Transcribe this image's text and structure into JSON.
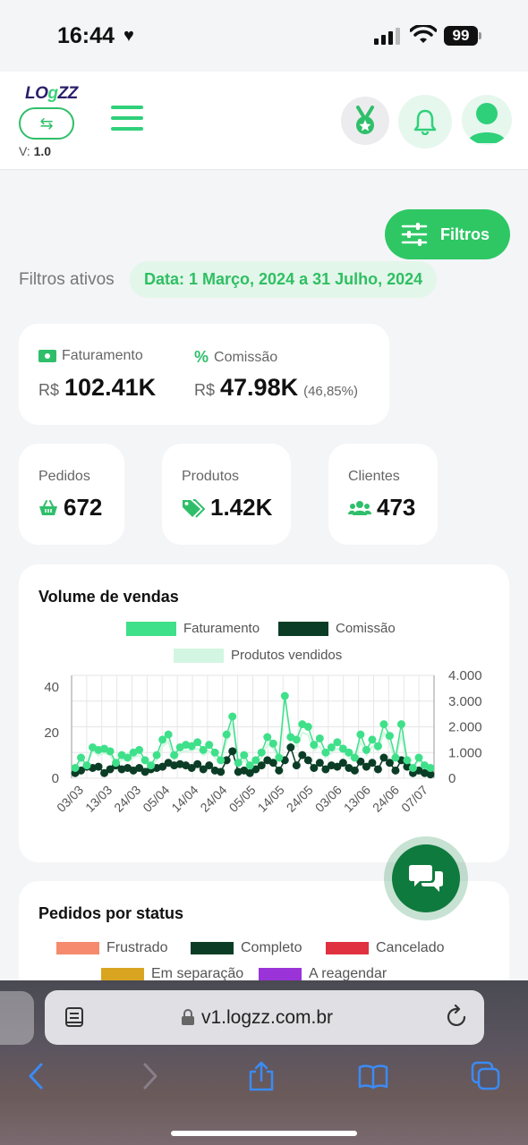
{
  "status_bar": {
    "time": "16:44",
    "battery": "99"
  },
  "header": {
    "logo_part1": "LO",
    "logo_part2": "g",
    "logo_part3": "ZZ",
    "version_prefix": "V:",
    "version": "1.0"
  },
  "filters": {
    "button_label": "Filtros",
    "active_label": "Filtros ativos",
    "date_chip": "Data: 1 Março, 2024 a 31 Julho, 2024"
  },
  "kpis": {
    "faturamento": {
      "label": "Faturamento",
      "currency": "R$",
      "value": "102.41K"
    },
    "comissao": {
      "label": "Comissão",
      "currency": "R$",
      "value": "47.98K",
      "percent": "(46,85%)"
    },
    "pedidos": {
      "label": "Pedidos",
      "value": "672"
    },
    "produtos": {
      "label": "Produtos",
      "value": "1.42K"
    },
    "clientes": {
      "label": "Clientes",
      "value": "473"
    }
  },
  "sales_chart": {
    "title": "Volume de vendas"
  },
  "chart_data": {
    "type": "line",
    "title": "Volume de vendas",
    "x_ticks": [
      "03/03",
      "13/03",
      "24/03",
      "05/04",
      "14/04",
      "24/04",
      "05/05",
      "14/05",
      "24/05",
      "03/06",
      "13/06",
      "24/06",
      "07/07"
    ],
    "y_left_ticks": [
      "0",
      "20",
      "40"
    ],
    "y_right_ticks": [
      "0",
      "1.000",
      "2.000",
      "3.000",
      "4.000"
    ],
    "ylim_left": [
      0,
      45
    ],
    "ylim_right": [
      0,
      4000
    ],
    "legend_position": "top",
    "grid": true,
    "colors": {
      "faturamento": "#3fe08a",
      "comissao": "#0b3d26",
      "produtos": "#d2f6e2"
    },
    "series": [
      {
        "name": "Faturamento",
        "axis": "right",
        "values": [
          400,
          800,
          500,
          1200,
          1100,
          1150,
          1050,
          600,
          900,
          800,
          1000,
          1100,
          700,
          500,
          900,
          1500,
          1700,
          900,
          1200,
          1300,
          1250,
          1400,
          1100,
          1300,
          1000,
          700,
          1700,
          2400,
          600,
          900,
          500,
          700,
          1000,
          1600,
          1350,
          800,
          3200,
          1600,
          1500,
          2100,
          2000,
          1300,
          1550,
          1000,
          1200,
          1400,
          1150,
          1000,
          800,
          1700,
          1100,
          1500,
          1250,
          2100,
          1650,
          800,
          2100,
          700,
          400,
          800,
          500,
          400
        ]
      },
      {
        "name": "Comissão",
        "axis": "right",
        "values": [
          200,
          300,
          450,
          400,
          450,
          200,
          350,
          500,
          350,
          400,
          300,
          400,
          250,
          350,
          400,
          450,
          600,
          500,
          550,
          500,
          400,
          550,
          350,
          500,
          300,
          250,
          700,
          1050,
          250,
          300,
          200,
          350,
          500,
          700,
          600,
          300,
          700,
          1200,
          500,
          900,
          700,
          400,
          600,
          350,
          500,
          450,
          600,
          400,
          300,
          650,
          450,
          600,
          350,
          800,
          600,
          300,
          700,
          450,
          200,
          300,
          200,
          150
        ]
      },
      {
        "name": "Produtos vendidos",
        "axis": "left",
        "values": [
          4,
          7,
          5,
          12,
          10,
          11,
          10,
          6,
          8,
          8,
          9,
          10,
          7,
          5,
          8,
          14,
          16,
          8,
          11,
          12,
          12,
          13,
          10,
          12,
          9,
          7,
          16,
          24,
          6,
          8,
          5,
          7,
          9,
          15,
          13,
          8,
          36,
          15,
          14,
          20,
          19,
          12,
          14,
          9,
          11,
          13,
          11,
          9,
          8,
          16,
          10,
          14,
          12,
          20,
          15,
          8,
          19,
          7,
          4,
          8,
          5,
          4
        ]
      }
    ]
  },
  "status_chart": {
    "title": "Pedidos por status",
    "legend": [
      {
        "name": "Frustrado",
        "color": "#f58a6e"
      },
      {
        "name": "Completo",
        "color": "#0b3d26"
      },
      {
        "name": "Cancelado",
        "color": "#e03141"
      },
      {
        "name": "Em separação",
        "color": "#d9a520"
      },
      {
        "name": "A reagendar",
        "color": "#9a34d9"
      }
    ]
  },
  "browser": {
    "url": "v1.logzz.com.br"
  }
}
